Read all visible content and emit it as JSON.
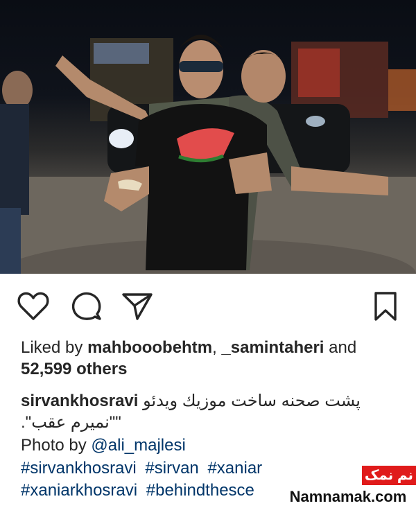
{
  "post": {
    "photo_alt": "",
    "actions": {
      "like_icon": "heart-icon",
      "comment_icon": "comment-bubble-icon",
      "share_icon": "paper-plane-icon",
      "save_icon": "bookmark-icon"
    },
    "likes": {
      "prefix": "Liked by ",
      "user1": "mahbooobehtm",
      "sep": ", ",
      "user2": "_samintaheri",
      "suffix": " and",
      "count": "52,599 others"
    },
    "caption": {
      "username": "sirvankhosravi",
      "text_line1": "پشت صحنه ساخت موزيك ويدئو",
      "text_line2": "\"\"نميرم عقب\"."
    },
    "credit": {
      "prefix": "Photo by ",
      "handle": "@ali_majlesi"
    },
    "hashtags": [
      "#sirvankhosravi",
      "#sirvan",
      "#xaniar",
      "#xaniarkhosravi",
      "#behindthesce"
    ]
  },
  "watermark": {
    "badge": "نم نمک",
    "site": "Namnamak.com",
    "badge_color": "#e01b1b"
  }
}
